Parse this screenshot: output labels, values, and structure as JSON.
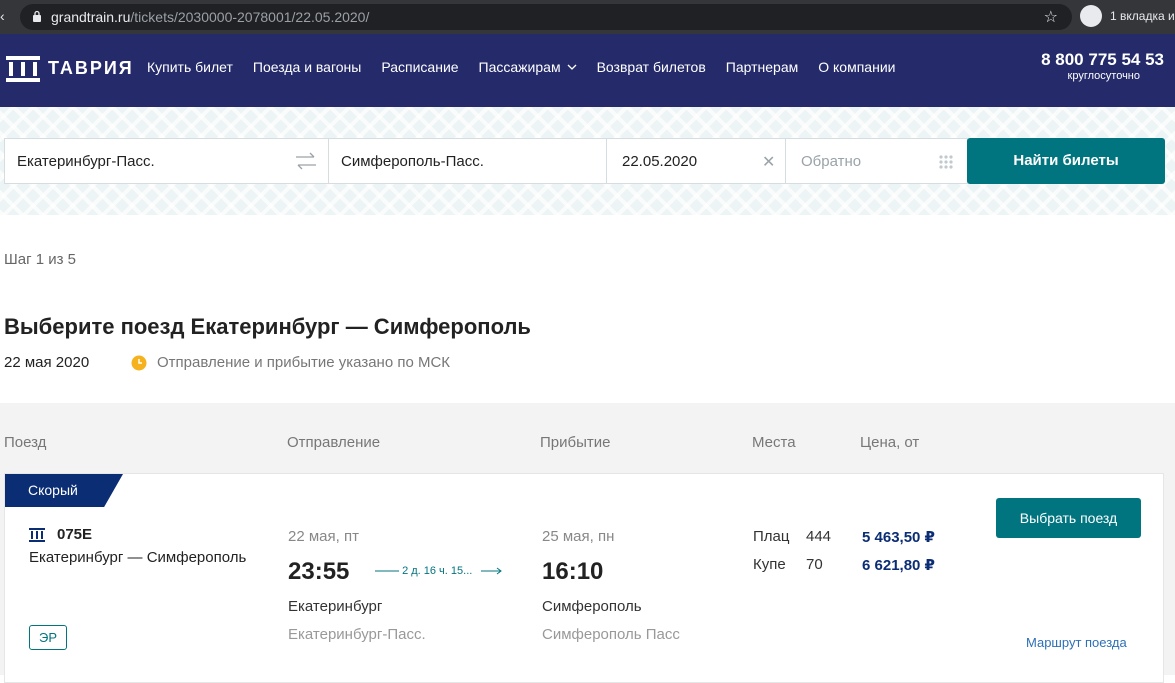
{
  "browser": {
    "url_host": "grandtrain.ru",
    "url_path": "/tickets/2030000-2078001/22.05.2020/",
    "incognito_text": "1 вкладка и"
  },
  "header": {
    "logo_text": "ТАВРИЯ",
    "nav": [
      {
        "label": "Купить билет"
      },
      {
        "label": "Поезда и вагоны"
      },
      {
        "label": "Расписание"
      },
      {
        "label": "Пассажирам"
      },
      {
        "label": "Возврат билетов"
      },
      {
        "label": "Партнерам"
      },
      {
        "label": "О компании"
      }
    ],
    "phone": "8 800 775 54 53",
    "phone_note": "круглосуточно"
  },
  "search": {
    "from": "Екатеринбург-Пасс.",
    "to": "Симферополь-Пасс.",
    "date": "22.05.2020",
    "return_placeholder": "Обратно",
    "submit_label": "Найти билеты"
  },
  "page": {
    "step": "Шаг 1 из 5",
    "title": "Выберите поезд Екатеринбург — Симферополь",
    "date": "22 мая 2020",
    "tz_note": "Отправление и прибытие указано по МСК"
  },
  "columns": {
    "train": "Поезд",
    "departure": "Отправление",
    "arrival": "Прибытие",
    "seats": "Места",
    "price": "Цена, от"
  },
  "train": {
    "category": "Скорый",
    "number": "075Е",
    "route": "Екатеринбург — Симферополь",
    "er_badge": "ЭР",
    "dep_date": "22 мая, пт",
    "dep_time": "23:55",
    "duration": "2 д. 16 ч. 15...",
    "dep_city": "Екатеринбург",
    "dep_station": "Екатеринбург-Пасс.",
    "arr_date": "25 мая, пн",
    "arr_time": "16:10",
    "arr_city": "Симферополь",
    "arr_station": "Симферополь Пасс",
    "seats": [
      {
        "type": "Плац",
        "count": "444",
        "price": "5 463,50 ₽"
      },
      {
        "type": "Купе",
        "count": "70",
        "price": "6 621,80 ₽"
      }
    ],
    "choose_label": "Выбрать поезд",
    "route_link": "Маршрут поезда"
  },
  "colors": {
    "header_bg": "#252b6a",
    "accent": "#00757f",
    "badge_bg": "#0b2d74"
  }
}
